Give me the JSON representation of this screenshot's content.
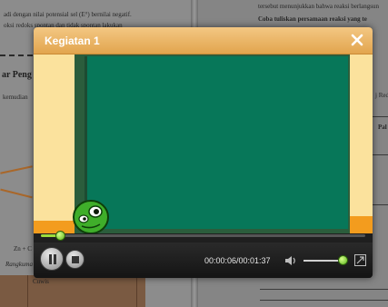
{
  "background": {
    "left_page": {
      "line1": "adi dengan nilai potensial sel (E°) bernilai negatif.",
      "line2": "oksi redoks spontan dan tidak spontan lakukan",
      "heading": "ar Peng",
      "line3": "kemudian",
      "equation_fragment": "Zn + C",
      "caption_fragment": "Rangkuma",
      "table_fragment": "Cuwis"
    },
    "right_page": {
      "line1": "tersebut menunjukkan bahwa reaksi berlangsun",
      "line2": "Coba tuliskan persamaan reaksi yang te",
      "side_fragment1": "j Red",
      "side_fragment2": "Pal"
    }
  },
  "modal": {
    "title": "Kegiatan 1",
    "close_icon": "close-icon"
  },
  "player": {
    "progress": 0.06,
    "time": "00:00:06/00:01:37",
    "volume": 0.95,
    "colors": {
      "accent": "#9ddc3c",
      "header": "#e2a54e",
      "board": "#077759"
    }
  }
}
